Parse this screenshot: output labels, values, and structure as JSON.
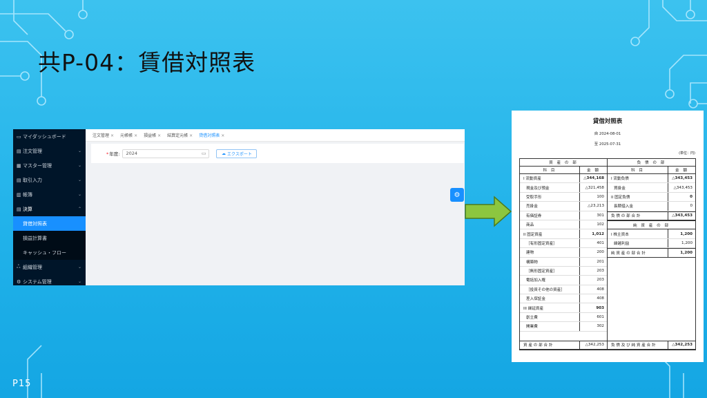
{
  "slide": {
    "title": "共P-04：賃借対照表",
    "page": "P15"
  },
  "app": {
    "sidebar": {
      "items": [
        {
          "icon": "dashboard-icon",
          "glyph": "▭",
          "label": "マイダッシュボード",
          "arrow": ""
        },
        {
          "icon": "order-icon",
          "glyph": "▤",
          "label": "注文管理",
          "arrow": "⌄"
        },
        {
          "icon": "master-icon",
          "glyph": "▦",
          "label": "マスター管理",
          "arrow": "⌄"
        },
        {
          "icon": "transaction-icon",
          "glyph": "▤",
          "label": "取引入力",
          "arrow": "⌄"
        },
        {
          "icon": "ledger-icon",
          "glyph": "▥",
          "label": "帳簿",
          "arrow": "⌄"
        },
        {
          "icon": "settlement-icon",
          "glyph": "▤",
          "label": "決算",
          "arrow": "⌃"
        }
      ],
      "submenu": [
        {
          "label": "貸借対照表",
          "active": true
        },
        {
          "label": "損益計算書",
          "active": false
        },
        {
          "label": "キャッシュ・フロー",
          "active": false
        }
      ],
      "bottom_items": [
        {
          "icon": "organization-icon",
          "glyph": "ஃ",
          "label": "組織管理",
          "arrow": "⌄"
        },
        {
          "icon": "settings-icon",
          "glyph": "⚙",
          "label": "システム管理",
          "arrow": "⌄"
        }
      ]
    },
    "tabs": [
      {
        "label": "注文管理",
        "active": false
      },
      {
        "label": "元帳帳",
        "active": false
      },
      {
        "label": "損益帳",
        "active": false
      },
      {
        "label": "結算定元帳",
        "active": false
      },
      {
        "label": "貸借対照表",
        "active": true
      }
    ],
    "tab_close": "×",
    "form": {
      "year_label": "年度:",
      "required_mark": "*",
      "year_value": "2024",
      "export_label": "エクスポート"
    }
  },
  "sheet": {
    "title": "貸借対照表",
    "from": "自 2024-08-01",
    "to": "至 2025-07-31",
    "unit": "(単位：円)",
    "assets_header": "資 産 の 部",
    "liabilities_header": "負 債 の 部",
    "col_item": "科 目",
    "col_amount": "金 額",
    "assets": [
      {
        "name": "I 流動資産",
        "amount": "△344,168",
        "bold": true,
        "indent": false
      },
      {
        "name": "現金及び預金",
        "amount": "△321,458",
        "bold": false,
        "indent": true
      },
      {
        "name": "受取手形",
        "amount": "100",
        "bold": false,
        "indent": true
      },
      {
        "name": "売掛金",
        "amount": "△23,213",
        "bold": false,
        "indent": true
      },
      {
        "name": "有価証券",
        "amount": "301",
        "bold": false,
        "indent": true
      },
      {
        "name": "商品",
        "amount": "102",
        "bold": false,
        "indent": true
      },
      {
        "name": "II 固定資産",
        "amount": "1,012",
        "bold": true,
        "indent": false
      },
      {
        "name": "［有形固定資産］",
        "amount": "401",
        "bold": false,
        "indent": true
      },
      {
        "name": "建物",
        "amount": "200",
        "bold": false,
        "indent": true
      },
      {
        "name": "構築物",
        "amount": "201",
        "bold": false,
        "indent": true
      },
      {
        "name": "［無形固定資産］",
        "amount": "203",
        "bold": false,
        "indent": true
      },
      {
        "name": "電話加入権",
        "amount": "203",
        "bold": false,
        "indent": true
      },
      {
        "name": "［投資その他の資産］",
        "amount": "408",
        "bold": false,
        "indent": true
      },
      {
        "name": "差入保証金",
        "amount": "408",
        "bold": false,
        "indent": true
      },
      {
        "name": "III 繰延資産",
        "amount": "903",
        "bold": true,
        "indent": false
      },
      {
        "name": "創立費",
        "amount": "601",
        "bold": false,
        "indent": true
      },
      {
        "name": "開業費",
        "amount": "302",
        "bold": false,
        "indent": true
      }
    ],
    "assets_total": {
      "name": "資 産 の 部 合 計",
      "amount": "△342,253"
    },
    "liabilities": [
      {
        "name": "I 流動負債",
        "amount": "△343,453",
        "bold": true,
        "indent": false
      },
      {
        "name": "買掛金",
        "amount": "△343,453",
        "bold": false,
        "indent": true
      },
      {
        "name": "II 固定負債",
        "amount": "0",
        "bold": true,
        "indent": false
      },
      {
        "name": "長期借入金",
        "amount": "0",
        "bold": false,
        "indent": true
      }
    ],
    "liabilities_total": {
      "name": "負 債 の 部 合 計",
      "amount": "△343,453"
    },
    "net_assets_header": "純 資 産 の 部",
    "net_assets": [
      {
        "name": "I 株主資本",
        "amount": "1,200",
        "bold": true,
        "indent": false
      },
      {
        "name": "繰越利益",
        "amount": "1,200",
        "bold": false,
        "indent": true
      }
    ],
    "net_assets_total": {
      "name": "純 資 産 の 部 合 計",
      "amount": "1,200"
    },
    "grand_total": {
      "name": "負 債 及 び 純 資 産 合 計",
      "amount": "△342,253"
    }
  },
  "colors": {
    "background": "#22b3ea",
    "sidebar": "#001529",
    "accent": "#1890ff",
    "arrow_fill": "#8cc63f"
  }
}
